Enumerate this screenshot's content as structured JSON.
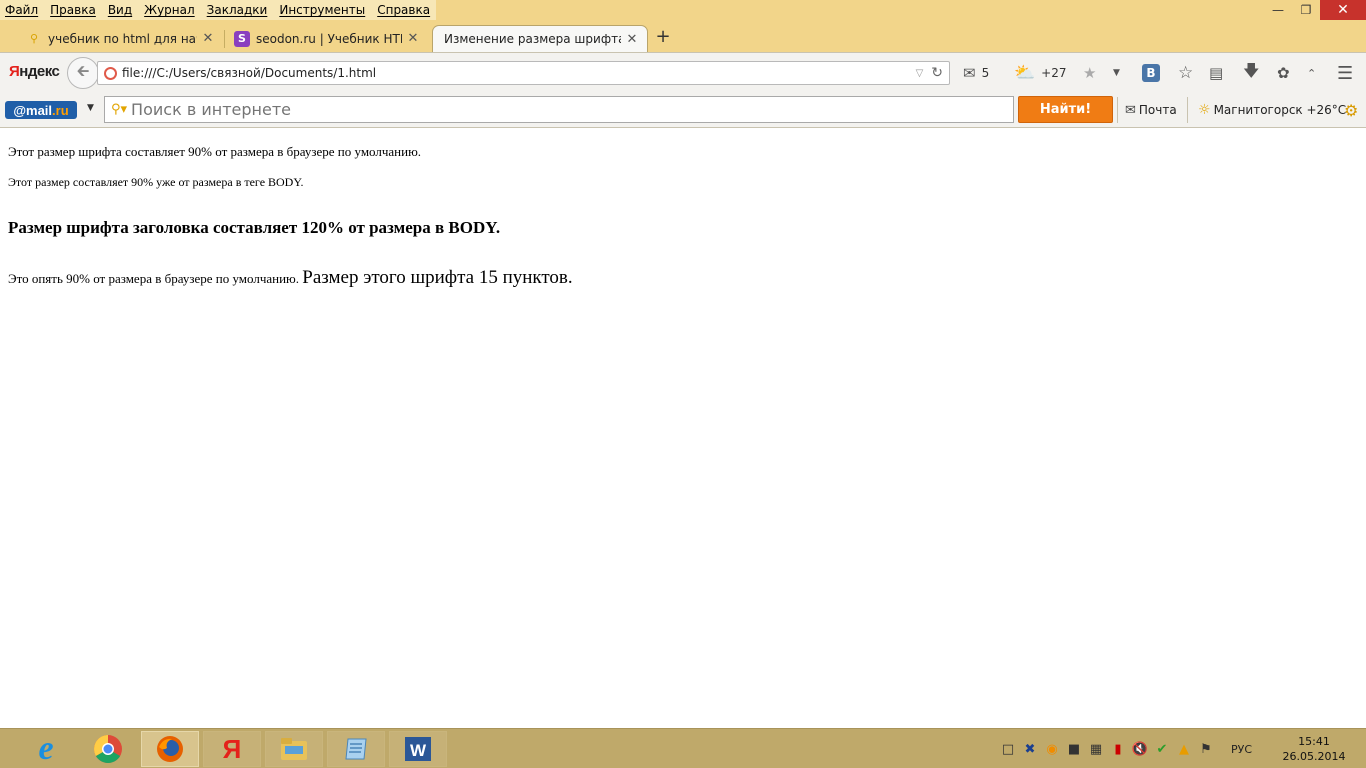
{
  "menu": [
    "Файл",
    "Правка",
    "Вид",
    "Журнал",
    "Закладки",
    "Инструменты",
    "Справка"
  ],
  "tabs": [
    {
      "title": "учебник по html для начи...",
      "icon": "search-icon"
    },
    {
      "title": "seodon.ru | Учебник HTM...",
      "icon": "seodon-icon"
    },
    {
      "title": "Изменение размера шрифта",
      "icon": "none",
      "active": true
    }
  ],
  "nav": {
    "logo": "Яндекс",
    "url": "file:///C:/Users/связной/Documents/1.html",
    "mail_count": "5",
    "weather_temp": "+27"
  },
  "mailru": {
    "logo_prefix": "@mail",
    "logo_suffix": ".ru",
    "search_placeholder": "Поиск в интернете",
    "find_button": "Найти!",
    "mail_link": "Почта",
    "weather": "Магнитогорск +26°C"
  },
  "page": {
    "p1": "Этот размер шрифта составляет 90% от размера в браузере по умолчанию.",
    "p2": "Этот размер составляет 90% уже от размера в теге BODY.",
    "heading": "Размер шрифта заголовка составляет 120% от размера в BODY.",
    "p3_small": "Это опять 90% от размера в браузере по умолчанию.",
    "p3_big": "Размер этого шрифта 15 пунктов."
  },
  "taskbar": {
    "apps": [
      "internet-explorer",
      "chrome",
      "firefox",
      "yandex-browser",
      "file-explorer",
      "notepad",
      "word"
    ],
    "language": "РУС",
    "time": "15:41",
    "date": "26.05.2014"
  },
  "colors": {
    "chrome_bg": "#f2d58a",
    "find_button": "#f07c14",
    "mailru_blue": "#1f5ea8",
    "taskbar": "#bfa96a"
  }
}
